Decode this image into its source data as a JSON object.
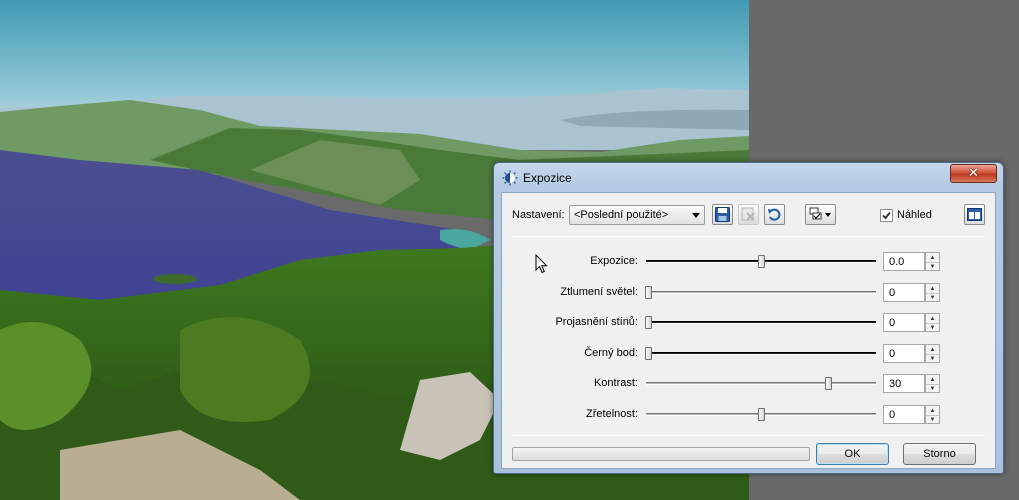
{
  "dialog": {
    "title": "Expozice",
    "close_glyph": "✕"
  },
  "toolbar": {
    "preset_label": "Nastavení:",
    "preset_value": "<Poslední použité>",
    "preview_label": "Náhled",
    "preview_checked": true,
    "icons": [
      "save-icon",
      "delete-preset-icon",
      "reset-icon",
      "options-checklist-icon",
      "layout-icon"
    ]
  },
  "sliders": [
    {
      "label": "Expozice:",
      "value": "0.0"
    },
    {
      "label": "Ztlumení světel:",
      "value": "0"
    },
    {
      "label": "Projasnění stínů:",
      "value": "0"
    },
    {
      "label": "Černý bod:",
      "value": "0"
    },
    {
      "label": "Kontrast:",
      "value": "30"
    },
    {
      "label": "Zřetelnost:",
      "value": "0"
    }
  ],
  "buttons": {
    "ok": "OK",
    "cancel": "Storno"
  },
  "colors": {
    "title_bar": "#b5cbe3",
    "close_button": "#c8432a",
    "canvas_background": "#696969",
    "default_button_border": "#3c7fb1"
  }
}
